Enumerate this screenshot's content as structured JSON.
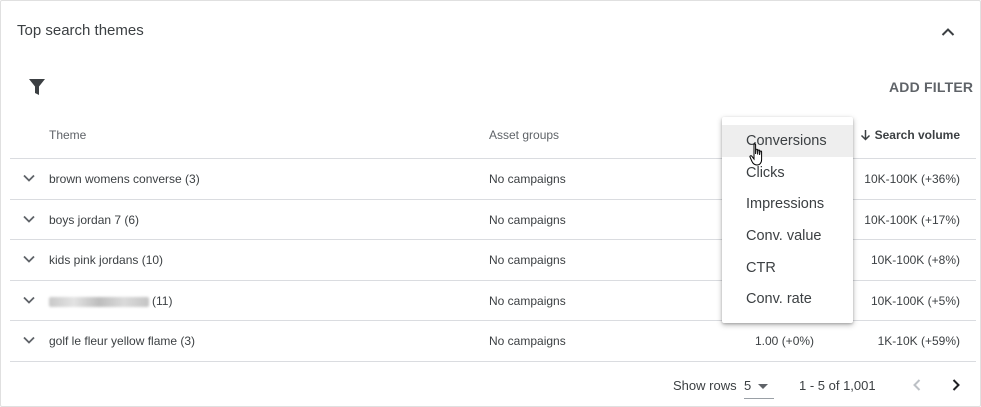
{
  "card": {
    "title": "Top search themes",
    "add_filter_label": "ADD FILTER"
  },
  "table": {
    "headers": {
      "theme": "Theme",
      "asset_groups": "Asset groups",
      "search_volume": "Search volume"
    },
    "rows": [
      {
        "theme": "brown womens converse (3)",
        "asset_groups": "No campaigns",
        "metric": "",
        "search_volume": "10K-100K (+36%)",
        "theme_blurred": false
      },
      {
        "theme": "boys jordan 7 (6)",
        "asset_groups": "No campaigns",
        "metric": "",
        "search_volume": "10K-100K (+17%)",
        "theme_blurred": false
      },
      {
        "theme": "kids pink jordans (10)",
        "asset_groups": "No campaigns",
        "metric": "",
        "search_volume": "10K-100K (+8%)",
        "theme_blurred": false
      },
      {
        "theme": "(11)",
        "asset_groups": "No campaigns",
        "metric": "",
        "search_volume": "10K-100K (+5%)",
        "theme_blurred": true
      },
      {
        "theme": "golf le fleur yellow flame (3)",
        "asset_groups": "No campaigns",
        "metric": "1.00 (+0%)",
        "search_volume": "1K-10K (+59%)",
        "theme_blurred": false
      }
    ]
  },
  "metric_menu": {
    "items": [
      "Conversions",
      "Clicks",
      "Impressions",
      "Conv. value",
      "CTR",
      "Conv. rate"
    ],
    "hovered": "Conversions"
  },
  "pagination": {
    "show_rows_label": "Show rows",
    "rows_per_page": "5",
    "range": "1 - 5 of 1,001"
  },
  "icons": {
    "collapse": "chevron-up-icon",
    "filter": "filter-icon",
    "sort": "arrow-down-icon",
    "expand_row": "chevron-down-icon",
    "rows_dropdown": "caret-down-icon",
    "prev_page": "chevron-left-icon",
    "next_page": "chevron-right-icon",
    "cursor": "hand-pointer-icon"
  },
  "colors": {
    "text": "#3c4043",
    "secondary_text": "#5f6368",
    "divider": "#dadce0",
    "menu_hover": "#eeeeee"
  }
}
